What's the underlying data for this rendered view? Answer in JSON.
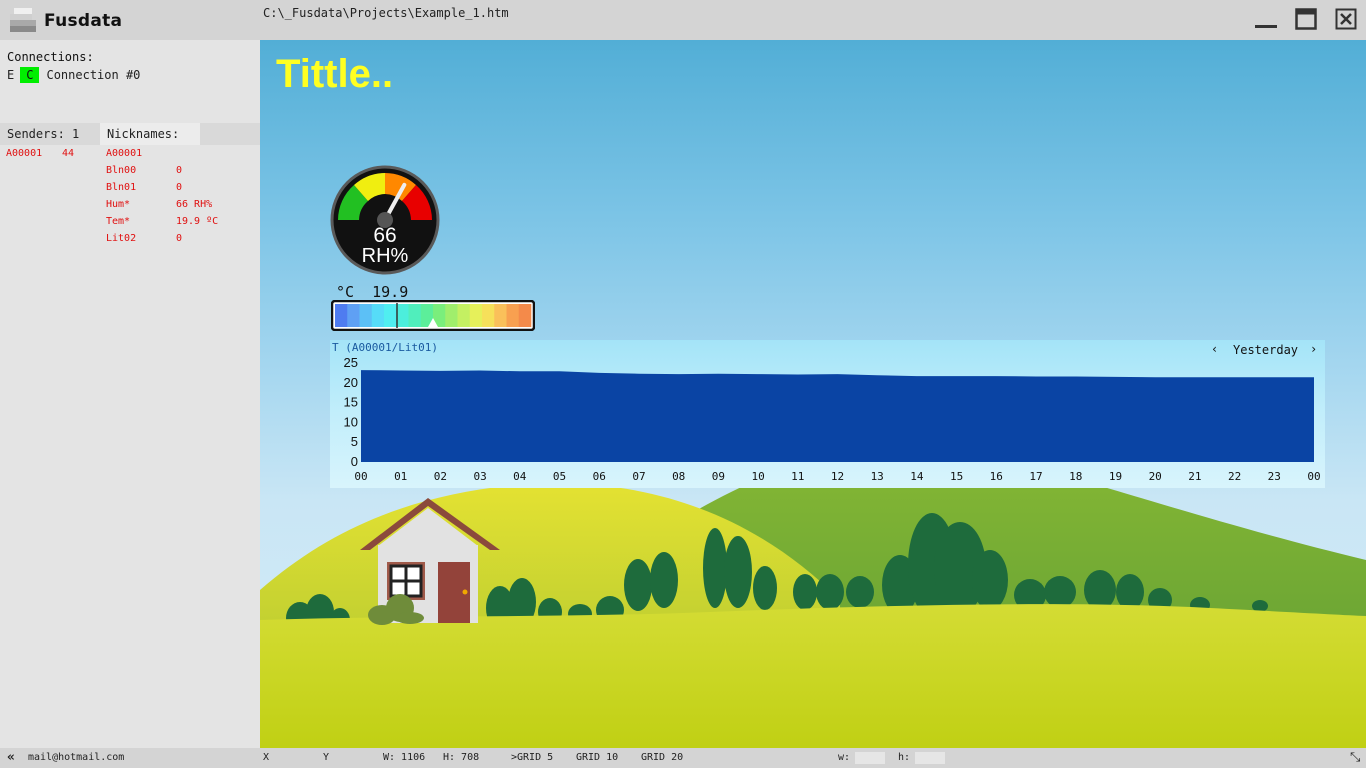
{
  "app": {
    "title": "Fusdata",
    "file_path": "C:\\_Fusdata\\Projects\\Example_1.htm"
  },
  "window_controls": [
    "minimize-icon",
    "maximize-icon",
    "close-icon"
  ],
  "connections": {
    "label": "Connections:",
    "items": [
      {
        "e": "E",
        "c": "C",
        "name": "Connection #0",
        "c_color": "#00ee00"
      }
    ]
  },
  "tabs": {
    "senders": "Senders: 1",
    "nicknames": "Nicknames:"
  },
  "senders": [
    {
      "id": "A00001",
      "value": "44"
    }
  ],
  "nicknames": [
    {
      "name": "A00001",
      "value": ""
    },
    {
      "name": "Bln00",
      "value": "0"
    },
    {
      "name": "Bln01",
      "value": "0"
    },
    {
      "name": "Hum*",
      "value": "66 RH%"
    },
    {
      "name": "Tem*",
      "value": "19.9 ºC"
    },
    {
      "name": "Lit02",
      "value": "0"
    }
  ],
  "canvas": {
    "title": "Tittle..",
    "title_color": "#ffff22"
  },
  "gauge": {
    "value": "66",
    "unit": "RH%",
    "level": 0.66
  },
  "thermometer": {
    "unit": "°C",
    "value": "19.9",
    "level": 0.5
  },
  "chart": {
    "series_label": "T (A00001/Lit01)",
    "period": "Yesterday",
    "prev": "‹",
    "next": "›"
  },
  "chart_data": {
    "type": "area",
    "x": [
      "00",
      "01",
      "02",
      "03",
      "04",
      "05",
      "06",
      "07",
      "08",
      "09",
      "10",
      "11",
      "12",
      "13",
      "14",
      "15",
      "16",
      "17",
      "18",
      "19",
      "20",
      "21",
      "22",
      "23",
      "00"
    ],
    "values": [
      23.2,
      23.1,
      23.0,
      23.1,
      22.9,
      22.9,
      22.5,
      22.3,
      22.2,
      22.3,
      22.2,
      22.1,
      22.2,
      21.9,
      21.7,
      21.7,
      21.7,
      21.6,
      21.6,
      21.5,
      21.4,
      21.4,
      21.4,
      21.4,
      21.4
    ],
    "ylim": [
      0,
      25
    ],
    "yticks": [
      0,
      5,
      10,
      15,
      20,
      25
    ],
    "fill_color": "#0a44a4"
  },
  "statusbar": {
    "collapse_icon": "«",
    "email": "mail@hotmail.com",
    "x": "X",
    "y": "Y",
    "w": "W: 1106",
    "h": "H: 708",
    "grid5": ">GRID 5",
    "grid10": "GRID 10",
    "grid20": "GRID 20",
    "w_small": "w:",
    "h_small": "h:",
    "resize_icon": "⤡"
  }
}
